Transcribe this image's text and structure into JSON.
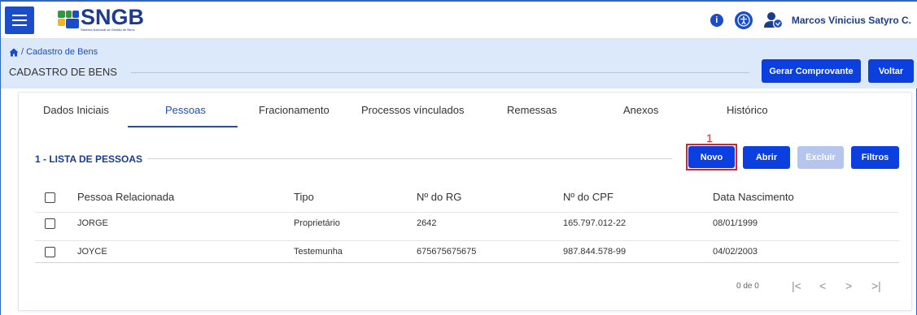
{
  "app": {
    "logo_title": "SNGB",
    "logo_subtitle": "Sistema Nacional de Gestão de Bens",
    "user_name": "Marcos Vinicius Satyro C."
  },
  "breadcrumb": {
    "text": "/ Cadastro de Bens"
  },
  "page": {
    "title": "CADASTRO DE BENS",
    "btn_gerar": "Gerar Comprovante",
    "btn_voltar": "Voltar"
  },
  "tabs": [
    {
      "label": "Dados Iniciais"
    },
    {
      "label": "Pessoas"
    },
    {
      "label": "Fracionamento"
    },
    {
      "label": "Processos vínculados"
    },
    {
      "label": "Remessas"
    },
    {
      "label": "Anexos"
    },
    {
      "label": "Histórico"
    }
  ],
  "section": {
    "title": "1 - LISTA DE PESSOAS",
    "annotation": "1",
    "btn_novo": "Novo",
    "btn_abrir": "Abrir",
    "btn_excluir": "Excluir",
    "btn_filtros": "Filtros"
  },
  "table": {
    "headers": [
      "Pessoa Relacionada",
      "Tipo",
      "Nº do RG",
      "Nº do CPF",
      "Data Nascimento"
    ],
    "rows": [
      [
        "JORGE",
        "Proprietário",
        "2642",
        "165.797.012-22",
        "08/01/1999"
      ],
      [
        "JOYCE",
        "Testemunha",
        "675675675675",
        "987.844.578-99",
        "04/02/2003"
      ]
    ]
  },
  "pagination": {
    "label": "0 de 0",
    "first": "|<",
    "prev": "<",
    "next": ">",
    "last": ">|"
  },
  "colors": {
    "primary": "#0b3fe0",
    "brand_dark": "#1a3b8f",
    "subheader_bg": "#dce9fb",
    "annotation_red": "#e0202a"
  }
}
